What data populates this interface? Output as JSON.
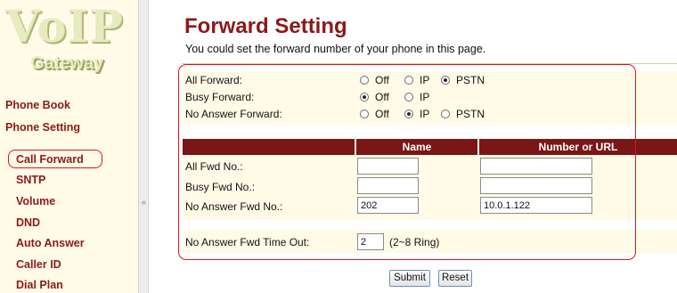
{
  "logo": {
    "title": "VoIP",
    "subtitle": "Gateway"
  },
  "sidebar": {
    "main_items": [
      "Phone Book",
      "Phone Setting"
    ],
    "sub_items": [
      "Call Forward",
      "SNTP",
      "Volume",
      "DND",
      "Auto Answer",
      "Caller ID",
      "Dial Plan"
    ],
    "selected": "Call Forward"
  },
  "page": {
    "title": "Forward Setting",
    "description": "You could set the forward number of your phone in this page."
  },
  "forward_modes": [
    {
      "label": "All Forward:",
      "options": [
        "Off",
        "IP",
        "PSTN"
      ],
      "selected": "PSTN"
    },
    {
      "label": "Busy Forward:",
      "options": [
        "Off",
        "IP"
      ],
      "selected": "Off"
    },
    {
      "label": "No Answer Forward:",
      "options": [
        "Off",
        "IP",
        "PSTN"
      ],
      "selected": "IP"
    }
  ],
  "table": {
    "columns": [
      "Name",
      "Number or URL"
    ],
    "rows": [
      {
        "label": "All Fwd No.:",
        "name": "",
        "number": ""
      },
      {
        "label": "Busy Fwd No.:",
        "name": "",
        "number": ""
      },
      {
        "label": "No Answer Fwd No.:",
        "name": "202",
        "number": "10.0.1.122"
      }
    ]
  },
  "timeout": {
    "label": "No Answer Fwd Time Out:",
    "value": "2",
    "hint": "(2~8 Ring)"
  },
  "buttons": {
    "submit": "Submit",
    "reset": "Reset"
  },
  "colors": {
    "accent": "#8b1a1a",
    "sidebar_bg": "#fffbe6",
    "header_bg": "#7a1616",
    "highlight": "#d81818"
  }
}
